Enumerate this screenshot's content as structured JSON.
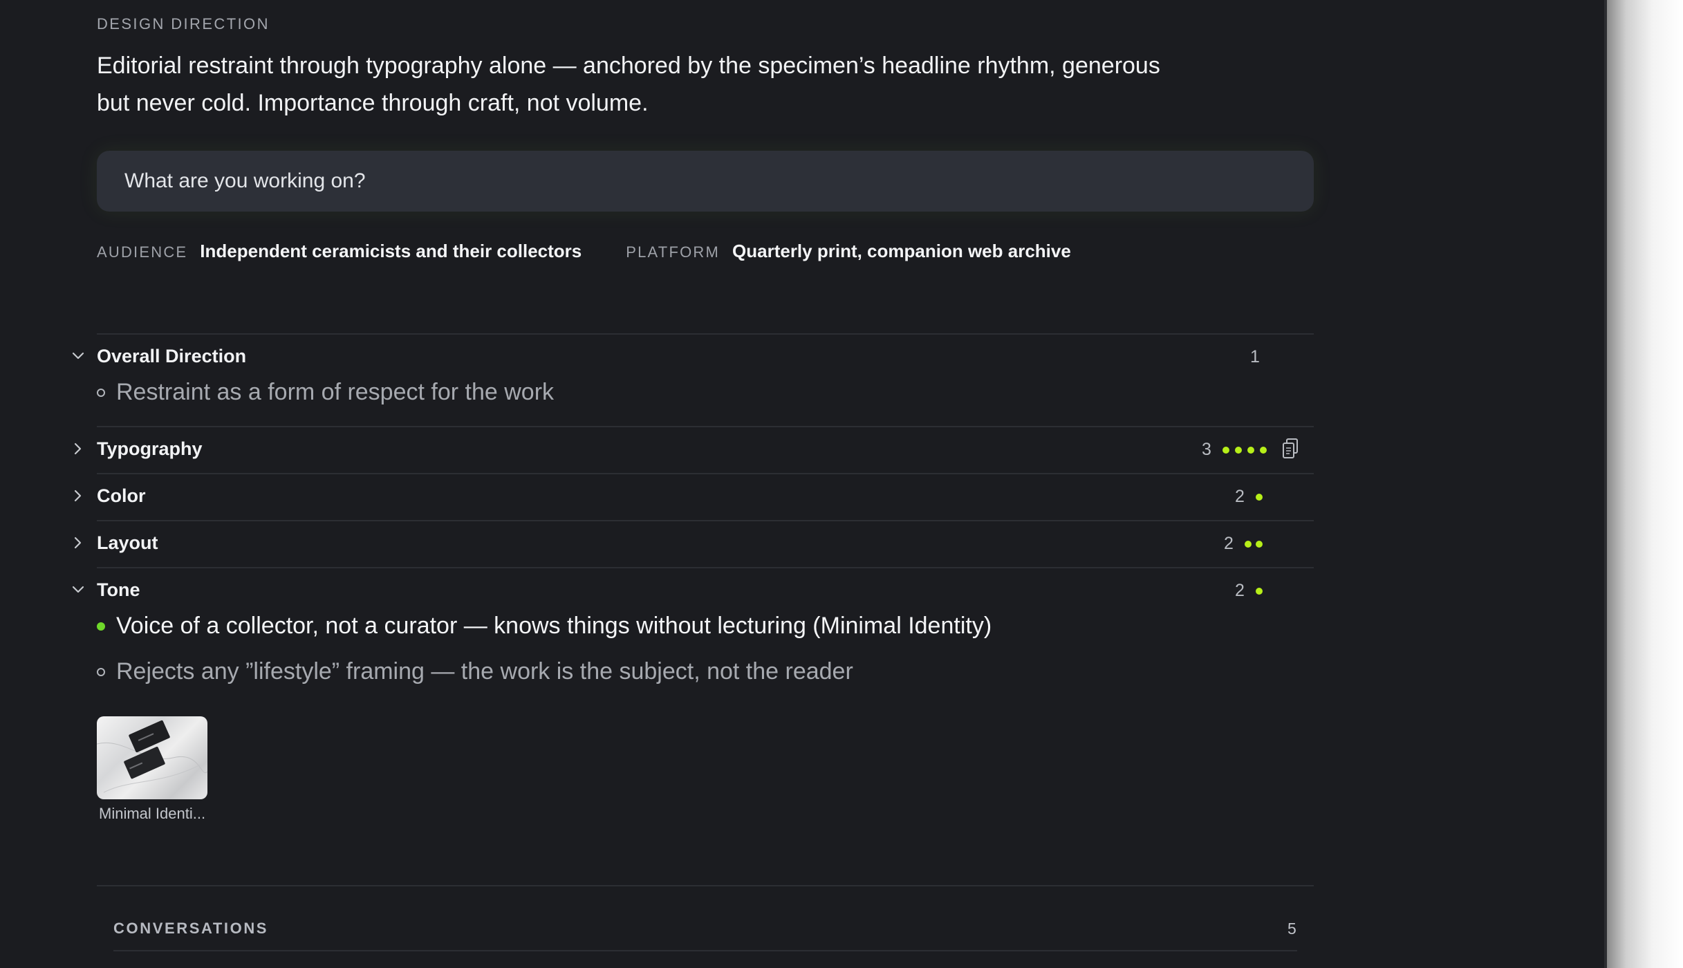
{
  "direction": {
    "eyebrow": "DESIGN DIRECTION",
    "headline_line1": "Editorial restraint through typography alone — anchored by the specimen’s headline rhythm, generous",
    "headline_line2": "but never cold. Importance through craft, not volume."
  },
  "prompt": {
    "placeholder": "What are you working on?"
  },
  "meta": {
    "audience_label": "AUDIENCE",
    "audience_value": "Independent ceramicists and their collectors",
    "platform_label": "PLATFORM",
    "platform_value": "Quarterly print, companion web archive"
  },
  "sections": [
    {
      "title": "Overall Direction",
      "count": "1",
      "expanded": true,
      "dots": 0,
      "items": [
        {
          "text": "Restraint as a form of respect for the work",
          "selected": false
        }
      ]
    },
    {
      "title": "Typography",
      "count": "3",
      "expanded": false,
      "dots": 4,
      "icon": "copy-icon"
    },
    {
      "title": "Color",
      "count": "2",
      "expanded": false,
      "dots": 1
    },
    {
      "title": "Layout",
      "count": "2",
      "expanded": false,
      "dots": 2
    },
    {
      "title": "Tone",
      "count": "2",
      "expanded": true,
      "dots": 1,
      "items": [
        {
          "text": "Voice of a collector, not a curator — knows things without lecturing (Minimal Identity)",
          "selected": true
        },
        {
          "text": "Rejects any ”lifestyle” framing — the work is the subject, not the reader",
          "selected": false
        }
      ]
    }
  ],
  "reference": {
    "label": "Minimal Identi..."
  },
  "conversations": {
    "label": "CONVERSATIONS",
    "count": "5"
  },
  "colors": {
    "background": "#1b1c20",
    "accent": "#b7ef19",
    "selected_bullet": "#6fd82a",
    "input_bg": "#2d3038"
  }
}
